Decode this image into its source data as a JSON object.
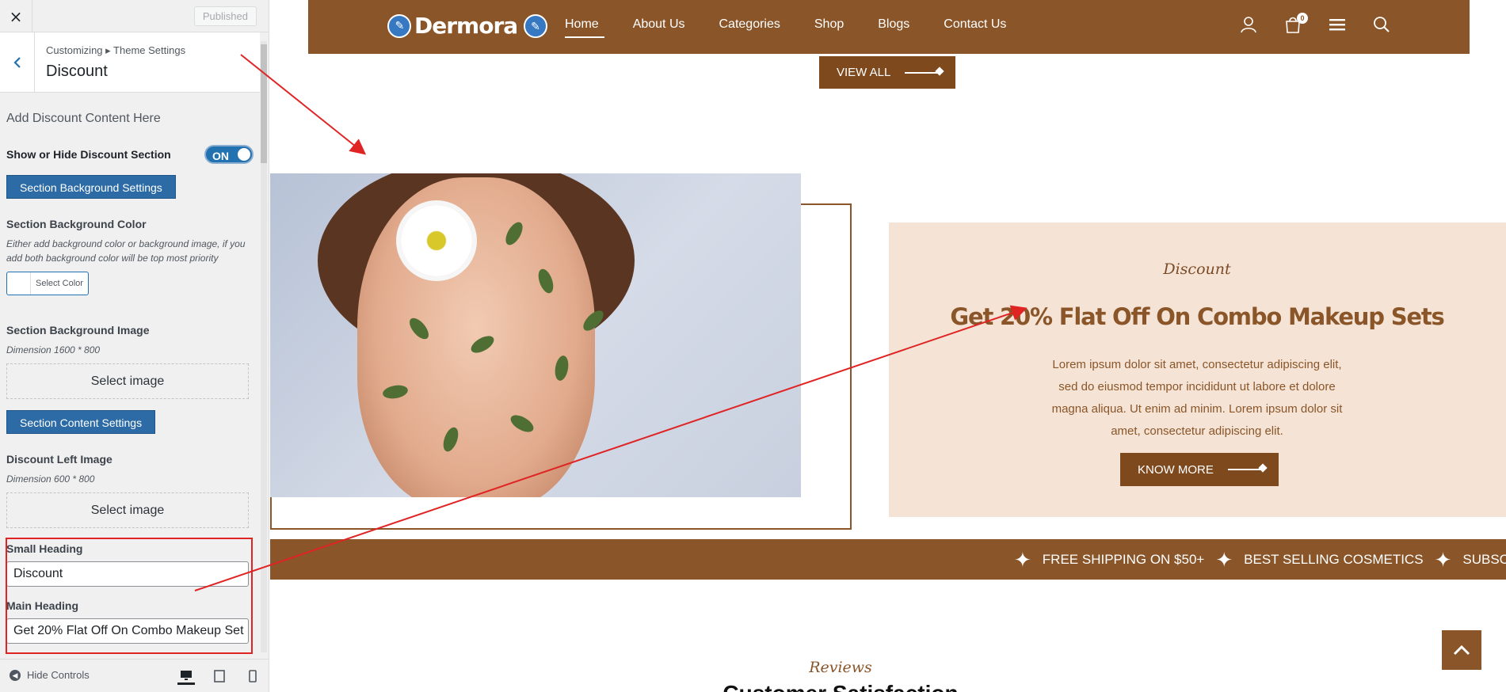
{
  "sidebar": {
    "close_icon": "×",
    "published_label": "Published",
    "breadcrumb": "Customizing ▸ Theme Settings",
    "section_title": "Discount",
    "intro": "Add Discount Content Here",
    "toggle_label": "Show or Hide Discount Section",
    "toggle_value": "ON",
    "bg_settings_btn": "Section Background Settings",
    "bg_color_label": "Section Background Color",
    "bg_color_desc": "Either add background color or background image, if you add both background color will be top most priority",
    "select_color": "Select Color",
    "bg_image_label": "Section Background Image",
    "bg_image_dim": "Dimension 1600 * 800",
    "select_image": "Select image",
    "content_settings_btn": "Section Content Settings",
    "left_image_label": "Discount Left Image",
    "left_image_dim": "Dimension 600 * 800",
    "select_image_2": "Select image",
    "small_heading_label": "Small Heading",
    "small_heading_value": "Discount",
    "main_heading_label": "Main Heading",
    "main_heading_value": "Get 20% Flat Off On Combo Makeup Set",
    "hide_controls": "Hide Controls"
  },
  "site": {
    "logo": "Dermora",
    "nav": [
      "Home",
      "About Us",
      "Categories",
      "Shop",
      "Blogs",
      "Contact Us"
    ],
    "cart_count": "0",
    "view_all": "VIEW ALL",
    "discount_small": "Discount",
    "discount_heading": "Get 20% Flat Off On Combo Makeup Sets",
    "discount_body": "Lorem ipsum dolor sit amet, consectetur adipiscing elit, sed do eiusmod tempor incididunt ut labore et dolore magna aliqua. Ut enim ad minim. Lorem ipsum dolor sit amet, consectetur adipiscing elit.",
    "know_more": "KNOW MORE",
    "marquee": [
      "FREE SHIPPING ON $50+",
      "BEST SELLING COSMETICS",
      "SUBSCR"
    ],
    "reviews_sub": "Reviews",
    "reviews_title": "Customer Satisfaction"
  },
  "colors": {
    "brand_brown": "#8a5528",
    "discount_bg": "#f5e4d6",
    "wp_blue": "#2271b1",
    "annotation_red": "#e02424"
  }
}
